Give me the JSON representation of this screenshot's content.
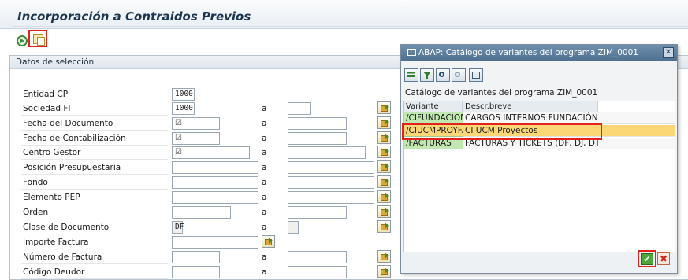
{
  "app": {
    "title": "Incorporación a Contraidos Previos"
  },
  "toolbar": {
    "execute_icon": "execute-icon",
    "variant_icon": "get-variant-icon"
  },
  "selection": {
    "header": "Datos de selección",
    "range_label": "a",
    "fields": [
      {
        "label": "Entidad CP",
        "low": "1000",
        "has_range": false
      },
      {
        "label": "Sociedad FI",
        "low": "1000",
        "has_range": true
      },
      {
        "label": "Fecha del Documento",
        "low": "☑",
        "has_range": true
      },
      {
        "label": "Fecha de Contabilización",
        "low": "☑",
        "has_range": true
      },
      {
        "label": "Centro Gestor",
        "low": "☑",
        "has_range": true
      },
      {
        "label": "Posición Presupuestaria",
        "low": "",
        "has_range": true
      },
      {
        "label": "Fondo",
        "low": "",
        "has_range": true
      },
      {
        "label": "Elemento PEP",
        "low": "",
        "has_range": true
      },
      {
        "label": "Orden",
        "low": "",
        "has_range": true
      },
      {
        "label": "Clase de Documento",
        "low": "DF",
        "has_range": true
      },
      {
        "label": "Importe Factura",
        "low": "",
        "has_range": false
      },
      {
        "label": "Número de Factura",
        "low": "",
        "has_range": true
      },
      {
        "label": "Código Deudor",
        "low": "",
        "has_range": true
      }
    ]
  },
  "dialog": {
    "title": "ABAP: Catálogo de variantes del programa ZIM_0001",
    "catalog_title": "Catálogo de variantes del programa ZIM_0001",
    "columns": [
      "Variante",
      "Descr.breve"
    ],
    "rows": [
      {
        "variant": "/CIFUNDACION",
        "description": "CARGOS INTERNOS FUNDACIÓN",
        "selected": false
      },
      {
        "variant": "/CIUCMPROYFA",
        "description": "CI UCM Proyectos",
        "selected": true
      },
      {
        "variant": "/FACTURAS",
        "description": "FACTURAS Y TICKETS (DF, DJ, DT",
        "selected": false
      }
    ],
    "ok_label": "✔",
    "cancel_label": "✖"
  },
  "colors": {
    "highlight_frame": "#e0231b",
    "variant_cell": "#c2e8b1",
    "selected_row": "#fbd875",
    "dialog_title_bar": "#5a7a99"
  }
}
